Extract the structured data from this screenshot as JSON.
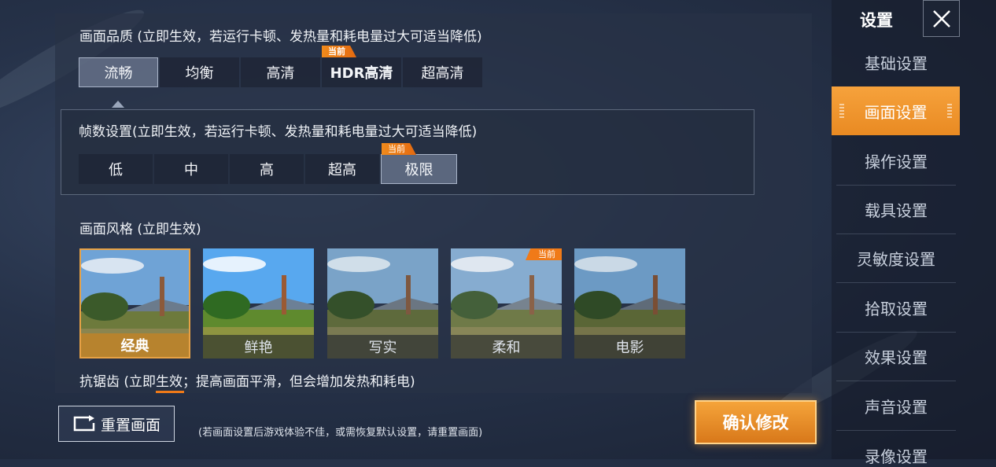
{
  "quality": {
    "title": "画面品质 (立即生效，若运行卡顿、发热量和耗电量过大可适当降低)",
    "options": [
      "流畅",
      "均衡",
      "高清",
      "HDR高清",
      "超高清"
    ],
    "current_tag": "当前"
  },
  "fps": {
    "title": "帧数设置(立即生效，若运行卡顿、发热量和耗电量过大可适当降低)",
    "options": [
      "低",
      "中",
      "高",
      "超高",
      "极限"
    ],
    "current_tag": "当前"
  },
  "style": {
    "title": "画面风格 (立即生效)",
    "options": [
      "经典",
      "鲜艳",
      "写实",
      "柔和",
      "电影"
    ],
    "current_tag": "当前"
  },
  "antialias": {
    "title": "抗锯齿 (立即生效；提高画面平滑，但会增加发热和耗电)"
  },
  "footer": {
    "reset_label": "重置画面",
    "hint": "(若画面设置后游戏体验不佳，或需恢复默认设置，请重置画面)",
    "confirm_label": "确认修改"
  },
  "sidebar": {
    "title": "设置",
    "items": [
      "基础设置",
      "画面设置",
      "操作设置",
      "载具设置",
      "灵敏度设置",
      "拾取设置",
      "效果设置",
      "声音设置",
      "录像设置"
    ]
  },
  "colors": {
    "accent": "#f0902a",
    "panel": "#283246"
  }
}
